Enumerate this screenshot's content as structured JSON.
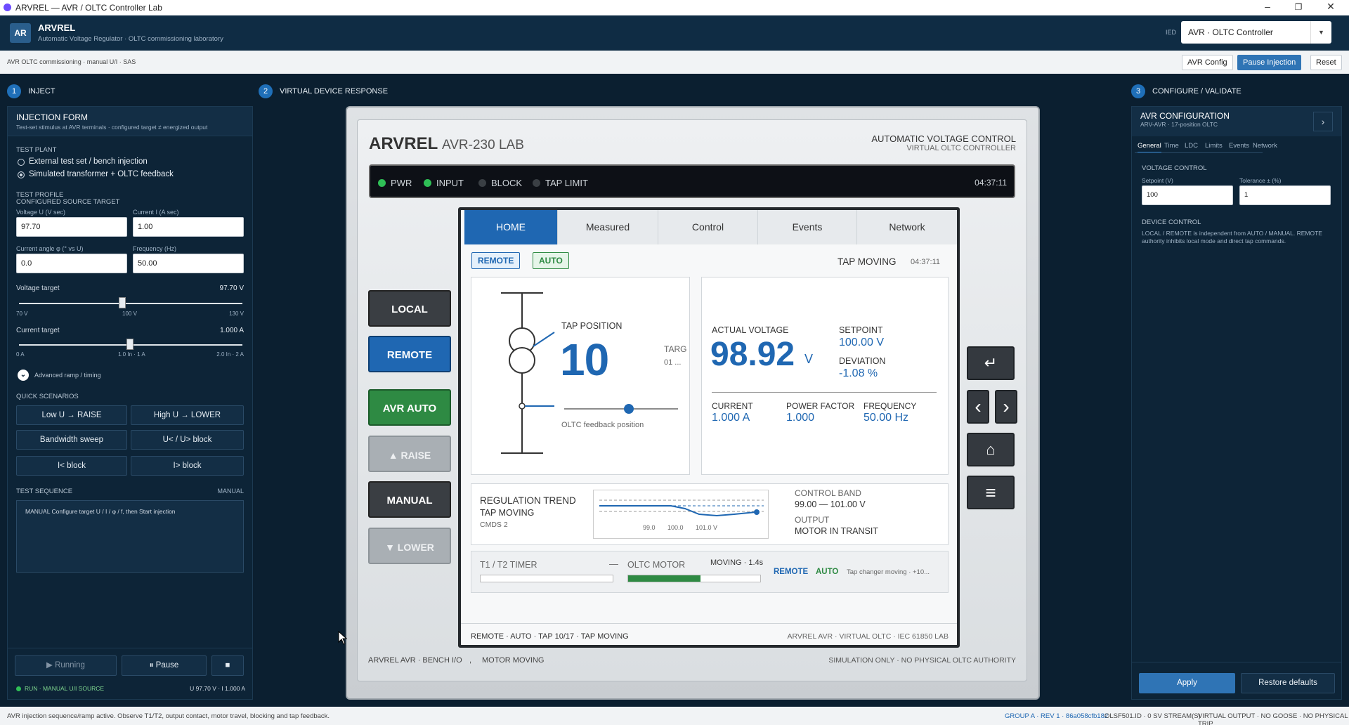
{
  "window": {
    "title": "ARVREL — AVR / OLTC Controller Lab"
  },
  "header": {
    "badge": "AR",
    "brand": "ARVREL",
    "subtitle": "Automatic Voltage Regulator · OLTC commissioning laboratory",
    "ied_label": "IED",
    "ied_value": "AVR · OLTC Controller"
  },
  "breadcrumb": {
    "text": "AVR   OLTC commissioning · manual U/I · SAS",
    "avr_config": "AVR Config",
    "pause_injection": "Pause Injection",
    "reset": "Reset"
  },
  "sections": {
    "s1_num": "1",
    "s1": "INJECT",
    "s2_num": "2",
    "s2": "VIRTUAL DEVICE RESPONSE",
    "s3_num": "3",
    "s3": "CONFIGURE / VALIDATE"
  },
  "inject": {
    "form_title": "INJECTION FORM",
    "form_sub": "Test-set stimulus at AVR terminals · configured target ≠ energized output",
    "plant_label": "TEST PLANT",
    "plant_opt1": "External test set / bench injection",
    "plant_opt2": "Simulated transformer + OLTC feedback",
    "profile_label": "TEST PROFILE",
    "profile_sub": "CONFIGURED SOURCE TARGET",
    "voltage_label": "Voltage U (V sec)",
    "voltage_value": "97.70",
    "current_label": "Current I (A sec)",
    "current_value": "1.00",
    "angle_label": "Current angle φ (° vs U)",
    "angle_value": "0.0",
    "freq_label": "Frequency (Hz)",
    "freq_value": "50.00",
    "vt_label": "Voltage target",
    "vt_value": "97.70 V",
    "vt_min": "70 V",
    "vt_mid": "100 V",
    "vt_max": "130 V",
    "ct_label": "Current target",
    "ct_value": "1.000 A",
    "ct_min": "0 A",
    "ct_mid": "1.0 In · 1 A",
    "ct_max": "2.0 In · 2 A",
    "advanced": "Advanced ramp / timing",
    "quick_label": "QUICK SCENARIOS",
    "q1": "Low U → RAISE",
    "q2": "High U → LOWER",
    "q3": "Bandwidth sweep",
    "q4": "U< / U> block",
    "q5": "I< block",
    "q6": "I> block",
    "seq_label": "TEST SEQUENCE",
    "seq_mode": "MANUAL",
    "seq_text": "MANUAL   Configure target U / I / φ / f, then Start injection",
    "running": "▶  Running",
    "pause": "⏸  Pause",
    "stop": "■",
    "run_status": "RUN · MANUAL U/I SOURCE",
    "run_values": "U 97.70 V · I 1.000 A"
  },
  "device": {
    "brand": "ARVREL",
    "model": "AVR-230 LAB",
    "title_r1": "AUTOMATIC VOLTAGE CONTROL",
    "title_r2": "VIRTUAL OLTC CONTROLLER",
    "led_pwr": "PWR",
    "led_input": "INPUT",
    "led_block": "BLOCK",
    "led_taplimit": "TAP LIMIT",
    "clock": "04:37:11",
    "btn_local": "LOCAL",
    "btn_remote": "REMOTE",
    "btn_avrauto": "AVR AUTO",
    "btn_raise": "▲ RAISE",
    "btn_manual": "MANUAL",
    "btn_lower": "▼ LOWER",
    "footer_left": "ARVREL AVR · BENCH I/O",
    "footer_sep": ",",
    "footer_mid": "MOTOR MOVING",
    "footer_right": "SIMULATION ONLY · NO PHYSICAL OLTC AUTHORITY",
    "nav": {
      "enter": "↵",
      "left": "‹",
      "right": "›",
      "home": "⌂",
      "menu": "≡"
    }
  },
  "screen": {
    "tabs": [
      "HOME",
      "Measured",
      "Control",
      "Events",
      "Network"
    ],
    "badge_remote": "REMOTE",
    "badge_auto": "AUTO",
    "state": "TAP MOVING",
    "state_time": "04:37:11",
    "tap_label": "TAP POSITION",
    "tap_value": "10",
    "target_label": "TARG",
    "target_value": "01 ...",
    "oltc_feedback": "OLTC feedback position",
    "actual_label": "ACTUAL VOLTAGE",
    "actual_value": "98.92",
    "actual_unit": "V",
    "setpoint_label": "SETPOINT",
    "setpoint_value": "100.00 V",
    "deviation_label": "DEVIATION",
    "deviation_value": "-1.08 %",
    "current_label": "CURRENT",
    "current_value": "1.000 A",
    "pf_label": "POWER FACTOR",
    "pf_value": "1.000",
    "freq_label": "FREQUENCY",
    "freq_value": "50.00 Hz",
    "trend_title": "REGULATION TREND",
    "trend_state": "TAP MOVING",
    "trend_cmds": "CMDS 2",
    "trend_ticks": [
      "99.0",
      "100.0",
      "101.0 V"
    ],
    "band_label": "CONTROL BAND",
    "band_value": "99.00 — 101.00 V",
    "output_label": "OUTPUT",
    "output_value": "MOTOR IN TRANSIT",
    "timer_label": "T1 / T2 TIMER",
    "timer_dash": "—",
    "motor_label": "OLTC MOTOR",
    "motor_state": "MOVING · 1.4s",
    "motor_progress": 0.55,
    "mini_remote": "REMOTE",
    "mini_auto": "AUTO",
    "mini_msg": "Tap changer moving · +10...",
    "footer_left": "REMOTE · AUTO · TAP 10/17 · TAP MOVING",
    "footer_right": "ARVREL AVR · VIRTUAL OLTC · IEC 61850 LAB"
  },
  "config": {
    "title": "AVR CONFIGURATION",
    "sub": "ARV-AVR · 17-position OLTC",
    "expand": "›",
    "tabs": [
      "General",
      "Time",
      "LDC",
      "Limits",
      "Events",
      "Network"
    ],
    "vc_label": "VOLTAGE CONTROL",
    "setpoint_label": "Setpoint (V)",
    "setpoint_value": "100",
    "tol_label": "Tolerance ± (%)",
    "tol_value": "1",
    "dc_label": "DEVICE CONTROL",
    "dc_text": "LOCAL / REMOTE is independent from AUTO / MANUAL. REMOTE authority inhibits local mode and direct tap commands.",
    "apply": "Apply",
    "restore": "Restore defaults"
  },
  "status": {
    "left": "AVR injection sequence/ramp active. Observe T1/T2, output contact, motor travel, blocking and tap feedback.",
    "group": "GROUP A · REV 1 · 86a058cfb182",
    "stream": "OLSF501.ID · 0 SV STREAM(S)",
    "output": "VIRTUAL OUTPUT · NO GOOSE · NO PHYSICAL TRIP"
  }
}
